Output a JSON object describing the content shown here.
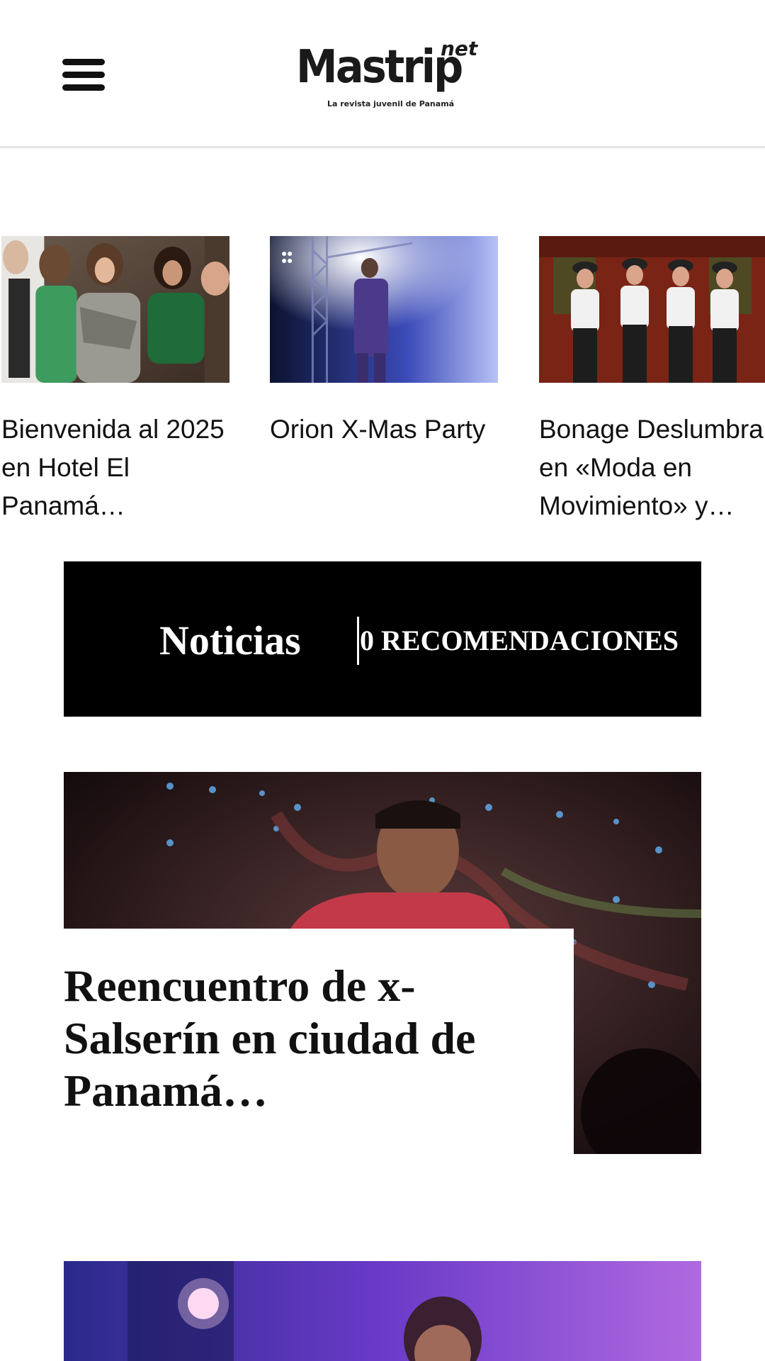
{
  "header": {
    "menu_icon": "hamburger-menu-icon",
    "logo": {
      "main": "Mastrip",
      "suffix": "net",
      "tagline": "La revista juvenil de Panamá"
    }
  },
  "carousel": [
    {
      "title": "Bienvenida al 2025 en Hotel El Panamá…"
    },
    {
      "title": "Orion X-Mas Party"
    },
    {
      "title": "Bonage Deslumbra en «Moda en Movimiento» y…"
    }
  ],
  "section": {
    "label": "Noticias",
    "recommendations": "0 RECOMENDACIONES"
  },
  "articles": [
    {
      "title": "Reencuentro de x-Salserín en ciudad de Panamá…"
    }
  ],
  "colors": {
    "section_bar": "#000000",
    "text": "#111111",
    "header_border": "#e6e6e6"
  }
}
